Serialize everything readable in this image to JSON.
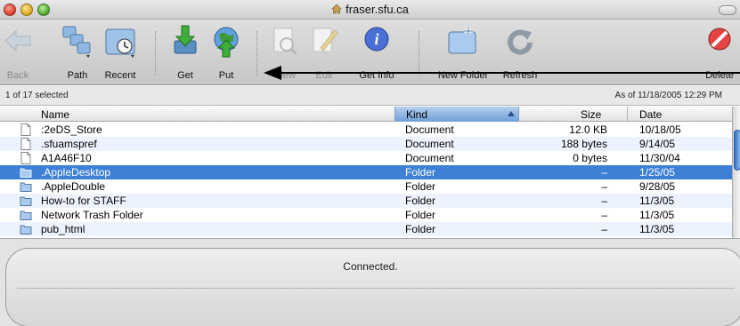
{
  "window": {
    "title": "fraser.sfu.ca"
  },
  "toolbar": {
    "back": "Back",
    "path": "Path",
    "recent": "Recent",
    "get": "Get",
    "put": "Put",
    "view": "View",
    "edit": "Edit",
    "get_info": "Get Info",
    "new_folder": "New Folder",
    "refresh": "Refresh",
    "delete": "Delete"
  },
  "status": {
    "selection": "1 of 17 selected",
    "as_of": "As of 11/18/2005 12:29 PM"
  },
  "columns": {
    "name": "Name",
    "kind": "Kind",
    "size": "Size",
    "date": "Date"
  },
  "files": [
    {
      "name": ":2eDS_Store",
      "kind": "Document",
      "size": "12.0 KB",
      "date": "10/18/05",
      "icon": "document-icon"
    },
    {
      "name": ".sfuamspref",
      "kind": "Document",
      "size": "188 bytes",
      "date": "9/14/05",
      "icon": "document-icon"
    },
    {
      "name": "A1A46F10",
      "kind": "Document",
      "size": "0 bytes",
      "date": "11/30/04",
      "icon": "document-icon"
    },
    {
      "name": ".AppleDesktop",
      "kind": "Folder",
      "size": "–",
      "date": "1/25/05",
      "icon": "folder-icon",
      "selected": true
    },
    {
      "name": ".AppleDouble",
      "kind": "Folder",
      "size": "–",
      "date": "9/28/05",
      "icon": "folder-icon"
    },
    {
      "name": "How-to for STAFF",
      "kind": "Folder",
      "size": "–",
      "date": "11/3/05",
      "icon": "folder-icon"
    },
    {
      "name": "Network Trash Folder",
      "kind": "Folder",
      "size": "–",
      "date": "11/3/05",
      "icon": "folder-icon"
    },
    {
      "name": "pub_html",
      "kind": "Folder",
      "size": "–",
      "date": "11/3/05",
      "icon": "folder-icon"
    }
  ],
  "footer": {
    "connection": "Connected."
  },
  "colors": {
    "selection": "#3d80d6",
    "alt_row": "#edf3fe",
    "sort_header": "#6f9fd8"
  }
}
